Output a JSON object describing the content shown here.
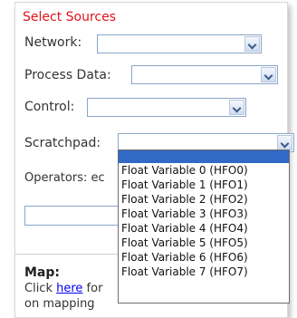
{
  "select_sources": {
    "title": "Select Sources",
    "network_label": "Network:",
    "process_data_label": "Process Data:",
    "control_label": "Control:",
    "scratchpad_label": "Scratchpad:"
  },
  "operators": {
    "label": "Operators:",
    "partial_value": "ec"
  },
  "map": {
    "heading": "Map:",
    "text_before_link": "Click ",
    "link_text": "here",
    "text_after_link": " for",
    "text_line2": "on mapping"
  },
  "scratchpad_dropdown": {
    "highlighted_option": "",
    "options": [
      "Float Variable 0 (HFO0)",
      "Float Variable 1 (HFO1)",
      "Float Variable 2 (HFO2)",
      "Float Variable 3 (HFO3)",
      "Float Variable 4 (HFO4)",
      "Float Variable 5 (HFO5)",
      "Float Variable 6 (HFO6)",
      "Float Variable 7 (HFO7)"
    ]
  },
  "colors": {
    "title": "#e0121b",
    "selection_highlight": "#3169c6",
    "select_border": "#8aa6c8",
    "link": "#0000ee"
  },
  "icons": {
    "select_arrow": "chevron-down-icon"
  }
}
